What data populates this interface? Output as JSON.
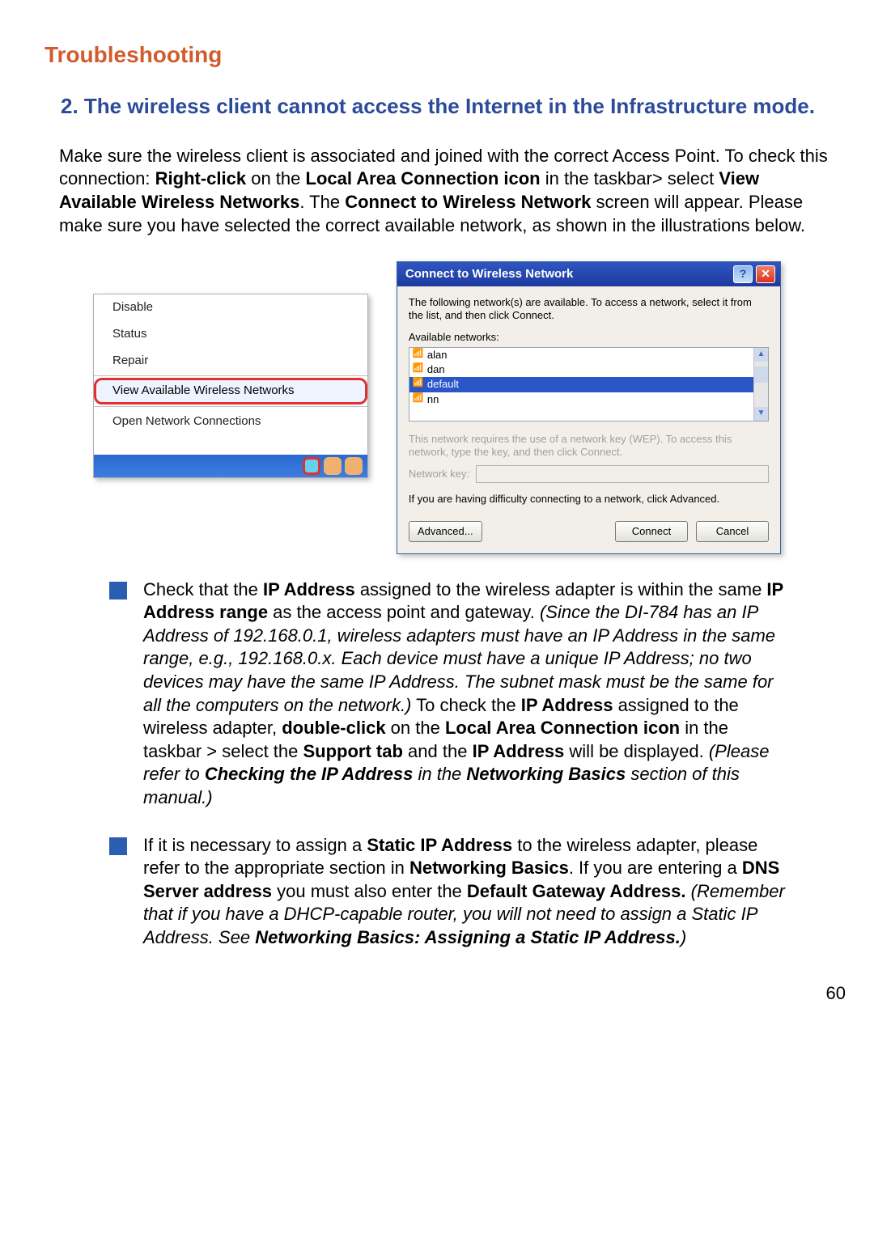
{
  "page_number": "60",
  "h1": "Troubleshooting",
  "h2_full": "2. The wireless client cannot access the Internet in the Infrastructure mode.",
  "intro": {
    "pre1": "Make sure the wireless client is associated and joined with the correct Access Point.  To check this connection: ",
    "bold1": "Right-click",
    "mid1": " on the ",
    "bold2": "Local Area Connection icon",
    "mid2": " in the taskbar> select ",
    "bold3": "View Available Wireless Networks",
    "mid3": ". The ",
    "bold4": "Connect to Wireless Network",
    "mid4": " screen will appear. Please make sure you have selected the correct available network, as shown in the illustrations below."
  },
  "context_menu": {
    "items": [
      "Disable",
      "Status",
      "Repair"
    ],
    "highlighted": "View Available Wireless Networks",
    "last": "Open Network Connections"
  },
  "dialog": {
    "title": "Connect to Wireless Network",
    "desc": "The following network(s) are available. To access a network, select it from the list, and then click Connect.",
    "available_label": "Available networks:",
    "networks": [
      "alan",
      "dan",
      "default",
      "nn"
    ],
    "selected_index": 2,
    "wep_text": "This network requires the use of a network key (WEP). To access this network, type the key, and then click Connect.",
    "key_label": "Network key:",
    "difficulty_text": "If you are having difficulty connecting to a network, click Advanced.",
    "btn_advanced": "Advanced...",
    "btn_connect": "Connect",
    "btn_cancel": "Cancel"
  },
  "bullet1": {
    "t1": "Check that the ",
    "b1": "IP Address",
    "t2": " assigned to the wireless adapter is within the same ",
    "b2": "IP Address range",
    "t3": " as the access point and gateway. ",
    "i1": "(Since the DI-784 has an IP Address of 192.168.0.1, wireless adapters must have an IP Address in the same range, e.g., 192.168.0.x. Each device must have a unique IP Address; no two devices may have the same IP Address. The subnet mask must be the same for all the computers on the network.)",
    "t4": " To check the ",
    "b3": "IP Address",
    "t5": " assigned to the wireless adapter, ",
    "b4": "double-click",
    "t6": " on the ",
    "b5": "Local Area Connection icon",
    "t7": " in the taskbar > select the ",
    "b6": "Support tab",
    "t8": " and the ",
    "b7": "IP Address",
    "t9": " will be displayed. ",
    "i2a": "(Please refer to ",
    "i2b": "Checking the IP Address",
    "i2c": " in the ",
    "i2d": "Networking Basics",
    "i2e": " section of this manual.)"
  },
  "bullet2": {
    "t1": "If it is necessary to assign a ",
    "b1": "Static IP Address",
    "t2": " to the wireless adapter, please refer to the appropriate section in ",
    "b2": "Networking Basics",
    "t3": ".  If you are entering a ",
    "b3": "DNS Server address",
    "t4": " you must also enter the ",
    "b4": "Default Gateway Address.",
    "t5": " ",
    "i1": "(Remember that if you have a DHCP-capable router, you will not need to assign a Static IP Address. See  ",
    "ib1": "Networking Basics: Assigning a Static IP Address.",
    "i2": ")"
  }
}
